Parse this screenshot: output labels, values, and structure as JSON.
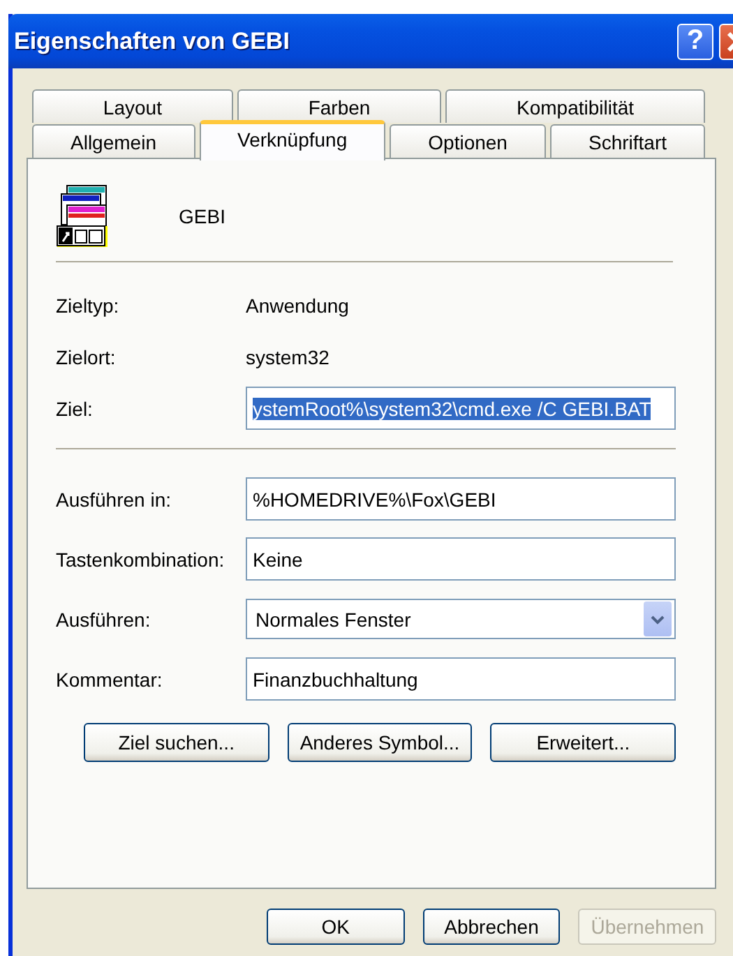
{
  "window": {
    "title": "Eigenschaften von GEBI",
    "help_button": "?"
  },
  "tab_rows": [
    {
      "tabs": [
        {
          "label": "Layout",
          "selected": false
        },
        {
          "label": "Farben",
          "selected": false
        },
        {
          "label": "Kompatibilität",
          "selected": false
        }
      ]
    },
    {
      "tabs": [
        {
          "label": "Allgemein",
          "selected": false
        },
        {
          "label": "Verknüpfung",
          "selected": true
        },
        {
          "label": "Optionen",
          "selected": false
        },
        {
          "label": "Schriftart",
          "selected": false
        }
      ]
    }
  ],
  "shortcut": {
    "name": "GEBI"
  },
  "info": [
    {
      "label": "Zieltyp:",
      "value": "Anwendung"
    },
    {
      "label": "Zielort:",
      "value": "system32"
    }
  ],
  "target": {
    "label": "Ziel:",
    "value": "ystemRoot%\\system32\\cmd.exe /C GEBI.BAT",
    "text_selected": true
  },
  "fields": [
    {
      "kind": "text",
      "label": "Ausführen in:",
      "value": "%HOMEDRIVE%\\Fox\\GEBI"
    },
    {
      "kind": "text",
      "label": "Tastenkombination:",
      "value": "Keine"
    },
    {
      "kind": "dropdown",
      "label": "Ausführen:",
      "value": "Normales Fenster"
    },
    {
      "kind": "text",
      "label": "Kommentar:",
      "value": "Finanzbuchhaltung"
    }
  ],
  "actions": [
    "Ziel suchen...",
    "Anderes Symbol...",
    "Erweitert..."
  ],
  "footer_buttons": [
    {
      "label": "OK",
      "disabled": false
    },
    {
      "label": "Abbrechen",
      "disabled": false
    },
    {
      "label": "Übernehmen",
      "disabled": true
    }
  ]
}
